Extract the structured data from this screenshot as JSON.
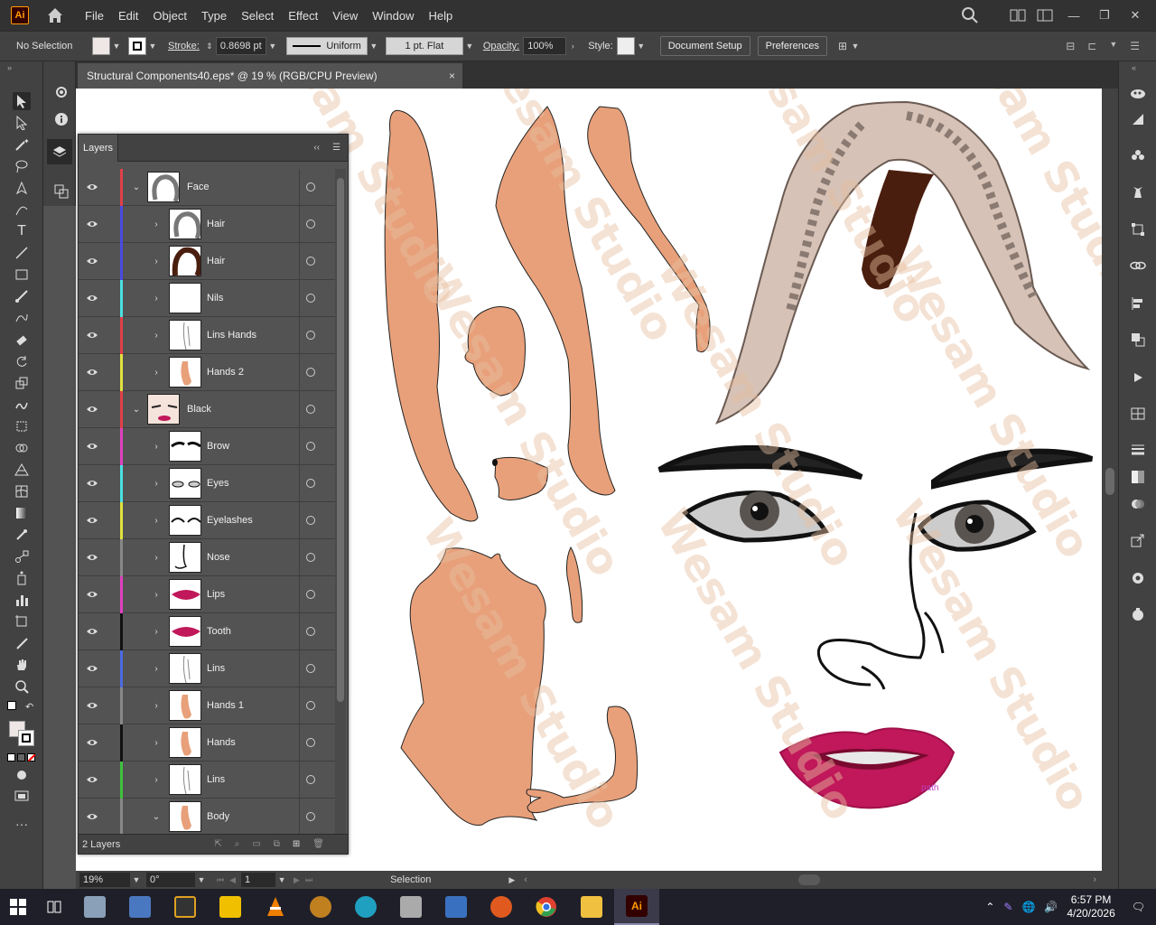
{
  "app": {
    "logo_text": "Ai",
    "menus": [
      "File",
      "Edit",
      "Object",
      "Type",
      "Select",
      "Effect",
      "View",
      "Window",
      "Help"
    ]
  },
  "control_bar": {
    "selection_text": "No Selection",
    "stroke_label": "Stroke:",
    "stroke_value": "0.8698 pt",
    "stroke_profile": "Uniform",
    "brush": "1 pt. Flat",
    "opacity_label": "Opacity:",
    "opacity_value": "100%",
    "style_label": "Style:",
    "document_setup": "Document Setup",
    "preferences": "Preferences"
  },
  "document": {
    "tab_title": "Structural Components40.eps* @ 19 % (RGB/CPU Preview)",
    "close_glyph": "×"
  },
  "layers": {
    "tab_label": "Layers",
    "footer_count": "2 Layers",
    "rows": [
      {
        "name": "Face",
        "color": "#e0404a",
        "level": 0,
        "expanded": true,
        "thumb": "hair"
      },
      {
        "name": "Hair",
        "color": "#4a4ae0",
        "level": 1,
        "expanded": false,
        "thumb": "hair"
      },
      {
        "name": "Hair",
        "color": "#4a4ae0",
        "level": 1,
        "expanded": false,
        "thumb": "hairdark"
      },
      {
        "name": "Nils",
        "color": "#4ae0e0",
        "level": 1,
        "expanded": false,
        "thumb": "blank"
      },
      {
        "name": "Lins Hands",
        "color": "#e0404a",
        "level": 1,
        "expanded": false,
        "thumb": "lines"
      },
      {
        "name": "Hands 2",
        "color": "#e0e040",
        "level": 1,
        "expanded": false,
        "thumb": "hand"
      },
      {
        "name": "Black",
        "color": "#e0404a",
        "level": 0,
        "expanded": true,
        "thumb": "face"
      },
      {
        "name": "Brow",
        "color": "#e040c0",
        "level": 1,
        "expanded": false,
        "thumb": "brow"
      },
      {
        "name": "Eyes",
        "color": "#4ae0e0",
        "level": 1,
        "expanded": false,
        "thumb": "eyes"
      },
      {
        "name": "Eyelashes",
        "color": "#e0e040",
        "level": 1,
        "expanded": false,
        "thumb": "lashes"
      },
      {
        "name": "Nose",
        "color": "#888888",
        "level": 1,
        "expanded": false,
        "thumb": "nose"
      },
      {
        "name": "Lips",
        "color": "#e040c0",
        "level": 1,
        "expanded": false,
        "thumb": "lips"
      },
      {
        "name": "Tooth",
        "color": "#111111",
        "level": 1,
        "expanded": false,
        "thumb": "lips"
      },
      {
        "name": "Lins",
        "color": "#4a6ae0",
        "level": 1,
        "expanded": false,
        "thumb": "lines"
      },
      {
        "name": "Hands 1",
        "color": "#888888",
        "level": 1,
        "expanded": false,
        "thumb": "hand"
      },
      {
        "name": "Hands",
        "color": "#111111",
        "level": 1,
        "expanded": false,
        "thumb": "hand"
      },
      {
        "name": "Lins",
        "color": "#40c040",
        "level": 1,
        "expanded": false,
        "thumb": "lines"
      },
      {
        "name": "Body",
        "color": "#888888",
        "level": 1,
        "expanded": true,
        "thumb": "hand"
      }
    ]
  },
  "status": {
    "zoom": "19%",
    "rotation": "0°",
    "artboard": "1",
    "tool": "Selection"
  },
  "canvas": {
    "watermark_text": "Wesam Studio",
    "path_label": "path"
  },
  "taskbar": {
    "time": "6:57 PM",
    "date": "4/20/2026"
  },
  "colors": {
    "skin": "#e8a07a",
    "lips": "#c0185a",
    "hair_dark": "#4a1e0e"
  }
}
